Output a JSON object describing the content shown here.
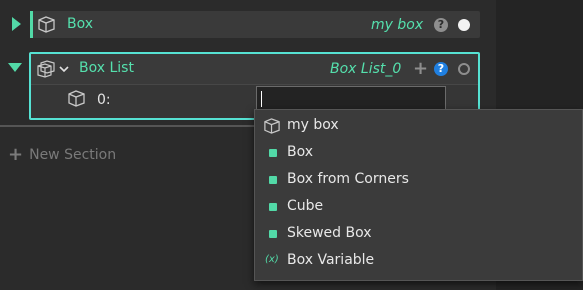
{
  "colors": {
    "accent": "#52d9a7",
    "selection_border": "#56e2d3",
    "help_blue": "#1f7fe0",
    "background": "#2b2b2b"
  },
  "rows": [
    {
      "label": "Box",
      "value": "my box",
      "help": "?",
      "icon": "cube-icon"
    }
  ],
  "list_section": {
    "label": "Box List",
    "value": "Box List_0",
    "add": "+",
    "help": "?",
    "icon": "cube-stack-icon",
    "items": [
      {
        "index": "0:",
        "input_value": ""
      }
    ]
  },
  "new_section": {
    "icon": "+",
    "label": "New Section"
  },
  "dropdown": {
    "items": [
      {
        "label": "my box",
        "icon": "cube-icon"
      },
      {
        "label": "Box",
        "icon": "type-dot-icon"
      },
      {
        "label": "Box from Corners",
        "icon": "type-dot-icon"
      },
      {
        "label": "Cube",
        "icon": "type-dot-icon"
      },
      {
        "label": "Skewed Box",
        "icon": "type-dot-icon"
      },
      {
        "label": "Box Variable",
        "icon": "variable-icon",
        "icon_text": "(x)"
      }
    ]
  }
}
